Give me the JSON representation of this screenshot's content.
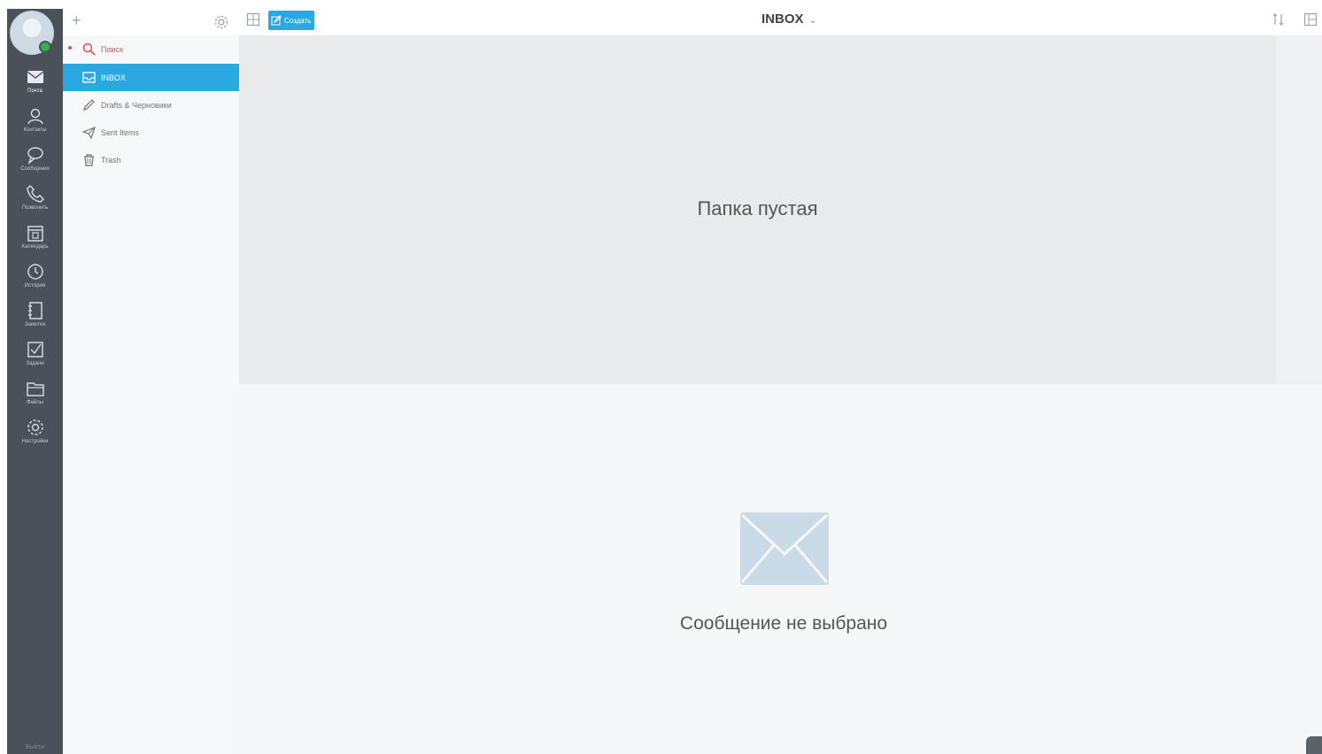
{
  "rail": {
    "items": [
      {
        "icon": "mail-icon",
        "label": "Почта",
        "active": true
      },
      {
        "icon": "contacts-icon",
        "label": "Контакты"
      },
      {
        "icon": "chat-icon",
        "label": "Сообщения"
      },
      {
        "icon": "phone-icon",
        "label": "Позвонить"
      },
      {
        "icon": "calendar-icon",
        "label": "Календарь"
      },
      {
        "icon": "clock-icon",
        "label": "История"
      },
      {
        "icon": "notes-icon",
        "label": "Заметки"
      },
      {
        "icon": "tasks-icon",
        "label": "Задачи"
      },
      {
        "icon": "folder-icon",
        "label": "Файлы"
      },
      {
        "icon": "settings-icon",
        "label": "Настройки"
      }
    ],
    "bottom_label": "Выйти"
  },
  "folders": {
    "search_label": "Поиск",
    "items": [
      {
        "label": "INBOX",
        "icon": "inbox-icon",
        "active": true
      },
      {
        "label": "Drafts & Черновики",
        "icon": "pencil-icon"
      },
      {
        "label": "Sent Items",
        "icon": "send-icon"
      },
      {
        "label": "Trash",
        "icon": "trash-icon"
      }
    ]
  },
  "toolbar": {
    "compose_label": "Создать",
    "folder_title": "INBOX",
    "chevron": "⌄"
  },
  "list": {
    "empty_text": "Папка пустая"
  },
  "preview": {
    "empty_text": "Сообщение не выбрано"
  },
  "colors": {
    "rail": "#4a5158",
    "accent": "#2aa9e0",
    "list_bg": "#e8eaec",
    "presence": "#35b24a",
    "search": "#d9534f"
  }
}
